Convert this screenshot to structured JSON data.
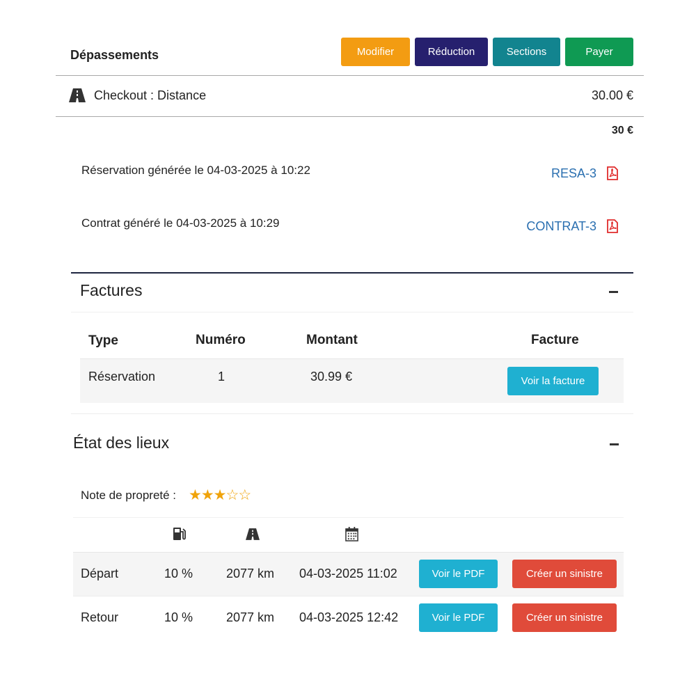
{
  "header": {
    "title": "Dépassements",
    "buttons": {
      "modifier": "Modifier",
      "reduction": "Réduction",
      "sections": "Sections",
      "payer": "Payer"
    },
    "button_colors": {
      "modifier": "#f39c12",
      "reduction": "#26206e",
      "sections": "#12848f",
      "payer": "#0f9a53"
    }
  },
  "overage": {
    "icon": "road-icon",
    "label": "Checkout : Distance",
    "amount": "30.00 €",
    "total": "30 €"
  },
  "documents": [
    {
      "text": "Réservation générée le 04-03-2025 à 10:22",
      "link": "RESA-3",
      "icon": "file-pdf-icon"
    },
    {
      "text": "Contrat généré le 04-03-2025 à 10:29",
      "link": "CONTRAT-3",
      "icon": "file-pdf-icon"
    }
  ],
  "factures": {
    "title": "Factures",
    "columns": {
      "type": "Type",
      "numero": "Numéro",
      "montant": "Montant",
      "facture": "Facture"
    },
    "rows": [
      {
        "type": "Réservation",
        "numero": "1",
        "montant": "30.99 €",
        "button": "Voir la facture"
      }
    ]
  },
  "etat_des_lieux": {
    "title": "État des lieux",
    "proprete_label": "Note de propreté :",
    "proprete_rating": 3,
    "proprete_max": 5,
    "column_icons": [
      "fuel-icon",
      "road-icon",
      "calendar-icon"
    ],
    "rows": [
      {
        "label": "Départ",
        "fuel": "10 %",
        "km": "2077 km",
        "date": "04-03-2025 11:02",
        "pdf_button": "Voir le PDF",
        "sinistre_button": "Créer un sinistre"
      },
      {
        "label": "Retour",
        "fuel": "10 %",
        "km": "2077 km",
        "date": "04-03-2025 12:42",
        "pdf_button": "Voir le PDF",
        "sinistre_button": "Créer un sinistre"
      }
    ]
  },
  "colors": {
    "info_button": "#1fb0d1",
    "danger_button": "#e04b3a",
    "link": "#2a6fb0",
    "pdf_icon": "#e02b2b",
    "star": "#f0a30a"
  }
}
